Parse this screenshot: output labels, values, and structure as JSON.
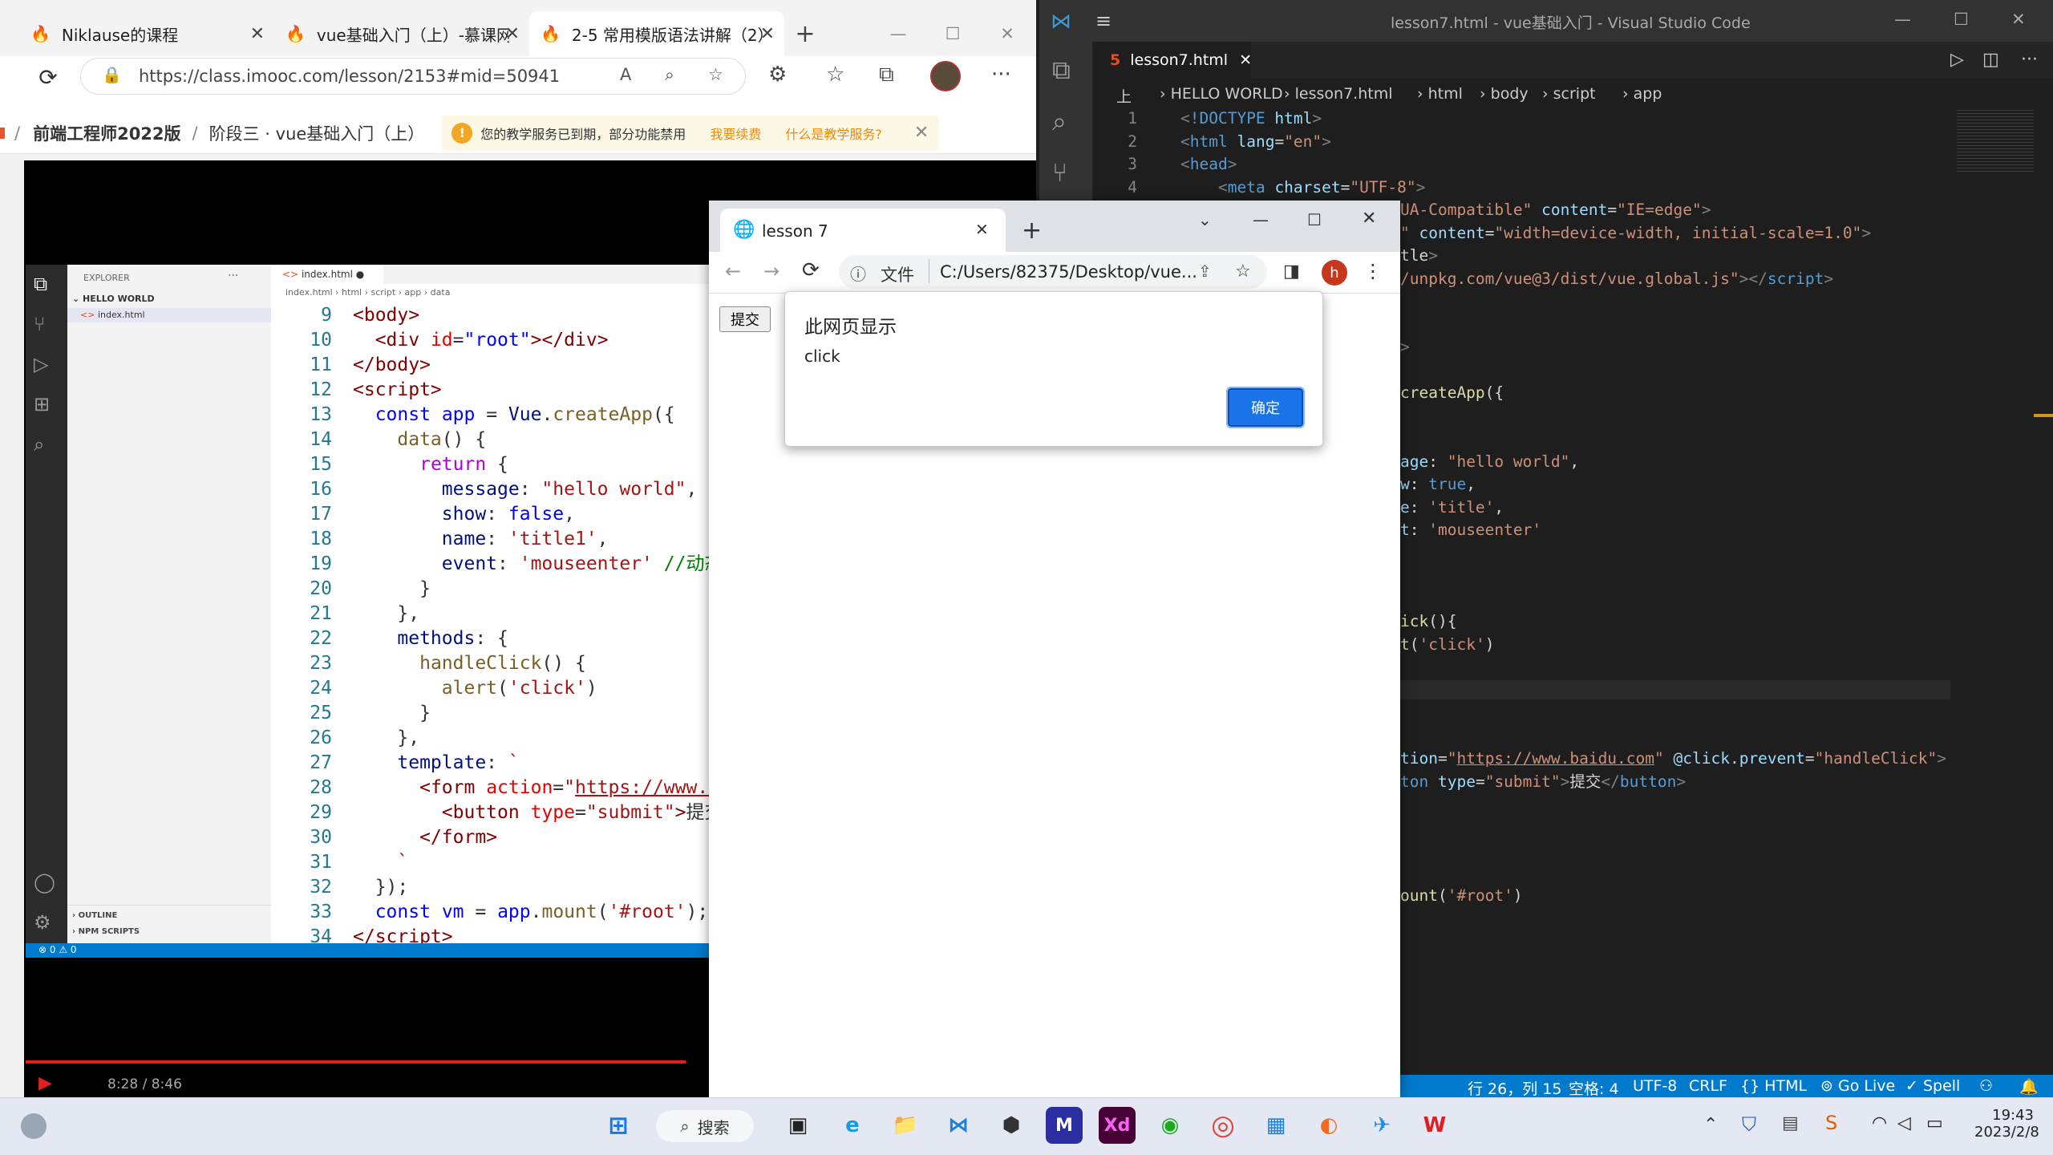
{
  "edge": {
    "tabs": [
      {
        "title": "Niklause的课程"
      },
      {
        "title": "vue基础入门（上）-慕课网"
      },
      {
        "title": "2-5 常用模版语法讲解（2）"
      }
    ],
    "new_tab": "+",
    "url": "https://class.imooc.com/lesson/2153#mid=50941",
    "crumb_course": "前端工程师2022版",
    "crumb_sep": "/",
    "crumb_stage": "阶段三 · vue基础入门（上）",
    "notice_text": "您的教学服务已到期，部分功能禁用",
    "notice_renew": "我要续费",
    "notice_what": "什么是教学服务?",
    "video_time": "8:28 / 8:46",
    "progress": 0.966
  },
  "inner_vscode": {
    "explorer_title": "EXPLORER",
    "folder": "HELLO WORLD",
    "file": "index.html",
    "tab": "index.html",
    "crumbs": [
      "index.html",
      "html",
      "script",
      "app",
      "data"
    ],
    "outline": "OUTLINE",
    "npm": "NPM SCRIPTS",
    "status": "⊗ 0 ⚠ 0",
    "lines": [
      {
        "n": "9",
        "html": "<span class=\"t\">&lt;body&gt;</span>"
      },
      {
        "n": "10",
        "html": "  <span class=\"t\">&lt;div</span> <span class=\"a\">id</span>=<span class=\"bl\">\"root\"</span><span class=\"t\">&gt;&lt;/div&gt;</span>"
      },
      {
        "n": "11",
        "html": "<span class=\"t\">&lt;/body&gt;</span>"
      },
      {
        "n": "12",
        "html": "<span class=\"t\">&lt;script&gt;</span>"
      },
      {
        "n": "13",
        "html": "  <span class=\"k\">const</span> <span class=\"bl\">app</span> = <span class=\"v\">Vue</span>.<span class=\"f\">createApp</span>({"
      },
      {
        "n": "14",
        "html": "    <span class=\"f\">data</span>() {"
      },
      {
        "n": "15",
        "html": "      <span class=\"kw\">return</span> {"
      },
      {
        "n": "16",
        "html": "        <span class=\"v\">message</span>: <span class=\"s\">\"hello world\"</span>,"
      },
      {
        "n": "17",
        "html": "        <span class=\"v\">show</span>: <span class=\"k\">false</span>,"
      },
      {
        "n": "18",
        "html": "        <span class=\"v\">name</span>: <span class=\"s\">'title1'</span>,"
      },
      {
        "n": "19",
        "html": "        <span class=\"v\">event</span>: <span class=\"s\">'mouseenter'</span> <span class=\"c\">//动态</span>"
      },
      {
        "n": "20",
        "html": "      }"
      },
      {
        "n": "21",
        "html": "    },"
      },
      {
        "n": "22",
        "html": "    <span class=\"v\">methods</span>: {"
      },
      {
        "n": "23",
        "html": "      <span class=\"f\">handleClick</span>() {"
      },
      {
        "n": "24",
        "html": "        <span class=\"f\">alert</span>(<span class=\"s\">'click'</span>)"
      },
      {
        "n": "25",
        "html": "      }"
      },
      {
        "n": "26",
        "html": "    },"
      },
      {
        "n": "27",
        "html": "    <span class=\"v\">template</span>: <span class=\"s\">`</span>"
      },
      {
        "n": "28",
        "html": "      <span class=\"t\">&lt;form</span> <span class=\"a\">action</span>=<span class=\"s\">\"<u>https://www.b</u></span>"
      },
      {
        "n": "29",
        "html": "        <span class=\"t\">&lt;button</span> <span class=\"a\">type</span>=<span class=\"s\">\"submit\"</span><span class=\"t\">&gt;</span>提交"
      },
      {
        "n": "30",
        "html": "      <span class=\"t\">&lt;/form&gt;</span>"
      },
      {
        "n": "31",
        "html": "    <span class=\"s\">`</span>"
      },
      {
        "n": "32",
        "html": "  });"
      },
      {
        "n": "33",
        "html": "  <span class=\"k\">const</span> <span class=\"bl\">vm</span> = <span class=\"bl\">app</span>.<span class=\"f\">mount</span>(<span class=\"s\">'#root'</span>);"
      },
      {
        "n": "34",
        "html": "<span class=\"t\">&lt;/script&gt;</span>"
      }
    ]
  },
  "vscode": {
    "title": "lesson7.html - vue基础入门 - Visual Studio Code",
    "tab": "lesson7.html",
    "crumbs": [
      "上",
      "HELLO WORLD",
      "lesson7.html",
      "html",
      "body",
      "script",
      "app"
    ],
    "lines": [
      {
        "n": "1",
        "html": "<span class=\"dP\">&lt;</span><span class=\"dt\">!DOCTYPE</span> <span class=\"dA\">html</span><span class=\"dP\">&gt;</span>"
      },
      {
        "n": "2",
        "html": "<span class=\"dP\">&lt;</span><span class=\"dt\">html</span> <span class=\"dA\">lang</span>=<span class=\"dS\">\"en\"</span><span class=\"dP\">&gt;</span>"
      },
      {
        "n": "3",
        "html": "<span class=\"dP\">&lt;</span><span class=\"dt\">head</span><span class=\"dP\">&gt;</span>"
      },
      {
        "n": "4",
        "html": "    <span class=\"dP\">&lt;</span><span class=\"dt\">meta</span> <span class=\"dA\">charset</span>=<span class=\"dS\">\"UTF-8\"</span><span class=\"dP\">&gt;</span>"
      }
    ],
    "right_snippets": [
      {
        "row": 4,
        "html": "<span class=\"dS\">UA-Compatible\"</span> <span class=\"dA\">content</span>=<span class=\"dS\">\"IE=edge\"</span><span class=\"dP\">&gt;</span>"
      },
      {
        "row": 5,
        "html": "<span class=\"dS\">\"</span> <span class=\"dA\">content</span>=<span class=\"dS\">\"width=device-width, initial-scale=1.0\"</span><span class=\"dP\">&gt;</span>"
      },
      {
        "row": 6,
        "html": "<span class=\"dW\">tle</span><span class=\"dP\">&gt;</span>"
      },
      {
        "row": 7,
        "html": "<span class=\"dS\">/unpkg.com/vue@3/dist/vue.global.js</span><span class=\"dS\">\"</span><span class=\"dP\">&gt;&lt;/</span><span class=\"dt\">script</span><span class=\"dP\">&gt;</span>"
      },
      {
        "row": 10,
        "html": "<span class=\"dP\">&gt;</span>"
      },
      {
        "row": 12,
        "html": "<span class=\"dY\">createApp</span>({"
      },
      {
        "row": 15,
        "html": "<span class=\"dA\">age</span>: <span class=\"dS\">\"hello world\"</span>,"
      },
      {
        "row": 16,
        "html": "<span class=\"dA\">w</span>: <span class=\"dB\">true</span>,"
      },
      {
        "row": 17,
        "html": "<span class=\"dA\">e</span>: <span class=\"dS\">'title'</span>,"
      },
      {
        "row": 18,
        "html": "<span class=\"dA\">t</span>: <span class=\"dS\">'mouseenter'</span>"
      },
      {
        "row": 22,
        "html": "<span class=\"dY\">ick</span>(){"
      },
      {
        "row": 23,
        "html": "<span class=\"dY\">t</span>(<span class=\"dS\">'click'</span>)"
      },
      {
        "row": 28,
        "html": "<span class=\"dA\">tion</span>=<span class=\"dS\">\"<u>https://www.baidu.com</u>\"</span> <span class=\"dA\">@click.prevent</span>=<span class=\"dS\">\"handleClick\"</span><span class=\"dP\">&gt;</span>"
      },
      {
        "row": 29,
        "html": "<span class=\"dt\">ton</span> <span class=\"dA\">type</span>=<span class=\"dS\">\"submit\"</span><span class=\"dP\">&gt;</span>提交<span class=\"dP\">&lt;/</span><span class=\"dt\">button</span><span class=\"dP\">&gt;</span>"
      },
      {
        "row": 34,
        "html": "<span class=\"dY\">ount</span>(<span class=\"dS\">'#root'</span>)"
      }
    ],
    "status": {
      "position": "行 26，列 15",
      "spaces": "空格: 4",
      "encoding": "UTF-8",
      "eol": "CRLF",
      "language": "{} HTML",
      "golive": "Go Live",
      "spell": "✓ Spell"
    }
  },
  "chrome": {
    "tab_title": "lesson 7",
    "new_tab": "+",
    "url_scheme": "文件",
    "url": "C:/Users/82375/Desktop/vue...",
    "avatar": "h",
    "submit_button": "提交",
    "alert": {
      "title": "此网页显示",
      "message": "click",
      "ok": "确定"
    }
  },
  "taskbar": {
    "search": "搜索",
    "time": "19:43",
    "date": "2023/2/8"
  },
  "colors": {
    "vscode_blue": "#007acc",
    "chrome_button": "#1a73e8",
    "edge_accent": "#e8542d"
  }
}
